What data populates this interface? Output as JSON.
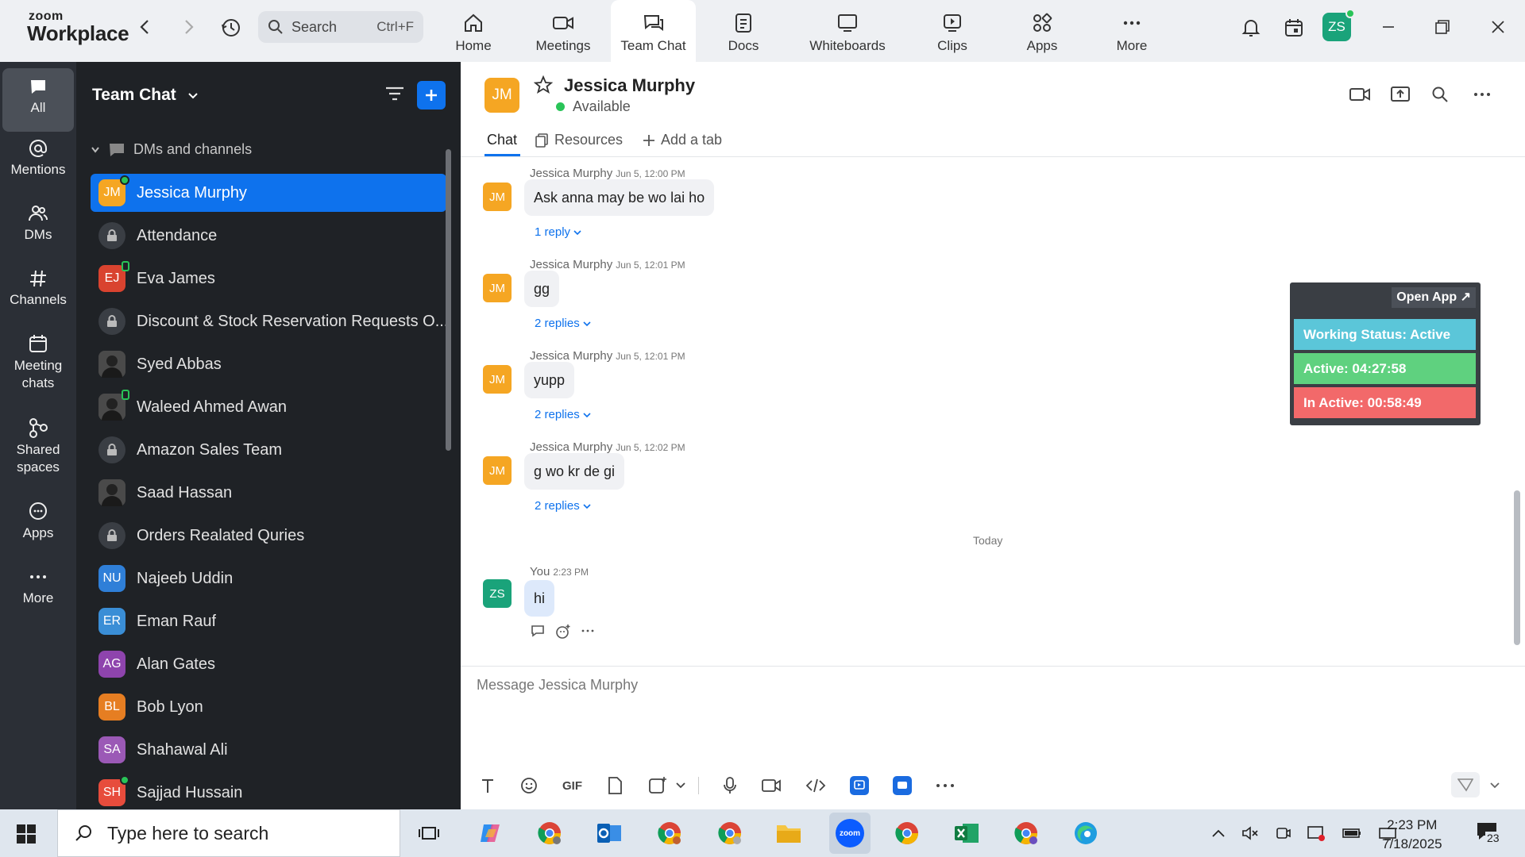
{
  "app": {
    "logo_top": "zoom",
    "logo_bottom": "Workplace"
  },
  "topbar": {
    "search_label": "Search",
    "search_shortcut": "Ctrl+F",
    "nav": [
      "Home",
      "Meetings",
      "Team Chat",
      "Docs",
      "Whiteboards",
      "Clips",
      "Apps",
      "More"
    ],
    "active_nav": "Team Chat",
    "user_initials": "ZS"
  },
  "rail": [
    "All",
    "Mentions",
    "DMs",
    "Channels",
    "Meeting chats",
    "Shared spaces",
    "Apps",
    "More"
  ],
  "sidebar": {
    "title": "Team Chat",
    "section": "DMs and channels",
    "items": [
      {
        "label": "Jessica Murphy",
        "initials": "JM",
        "kind": "avatar",
        "color": "#f5a623",
        "status": "green",
        "active": true
      },
      {
        "label": "Attendance",
        "kind": "lock"
      },
      {
        "label": "Eva James",
        "initials": "EJ",
        "kind": "avatar",
        "color": "#d9432f",
        "status": "phone"
      },
      {
        "label": "Discount & Stock Reservation Requests O...",
        "kind": "lock"
      },
      {
        "label": "Syed Abbas",
        "kind": "photo",
        "status": "clock"
      },
      {
        "label": "Waleed Ahmed Awan",
        "kind": "photo",
        "status": "phone"
      },
      {
        "label": "Amazon Sales Team",
        "kind": "lock"
      },
      {
        "label": "Saad Hassan",
        "kind": "photo",
        "status": "clock"
      },
      {
        "label": "Orders Realated Quries",
        "kind": "lock"
      },
      {
        "label": "Najeeb Uddin",
        "initials": "NU",
        "kind": "avatar",
        "color": "#2f7fd8",
        "status": "clock"
      },
      {
        "label": "Eman Rauf",
        "initials": "ER",
        "kind": "avatar",
        "color": "#3a8ed6",
        "status": "clock"
      },
      {
        "label": "Alan Gates",
        "initials": "AG",
        "kind": "avatar",
        "color": "#8e44ad",
        "status": "clock"
      },
      {
        "label": "Bob Lyon",
        "initials": "BL",
        "kind": "avatar",
        "color": "#e67e22",
        "status": "clock"
      },
      {
        "label": "Shahawal Ali",
        "initials": "SA",
        "kind": "avatar",
        "color": "#9b59b6",
        "status": "clock"
      },
      {
        "label": "Sajjad Hussain",
        "initials": "SH",
        "kind": "avatar",
        "color": "#e74c3c",
        "status": "green"
      }
    ]
  },
  "chat": {
    "contact_initials": "JM",
    "contact_name": "Jessica Murphy",
    "contact_status": "Available",
    "tabs": [
      "Chat",
      "Resources",
      "Add a tab"
    ],
    "messages": [
      {
        "author": "Jessica Murphy",
        "time": "Jun 5, 12:00 PM",
        "text": "Ask anna may be wo lai ho",
        "replies": "1 reply"
      },
      {
        "author": "Jessica Murphy",
        "time": "Jun 5, 12:01 PM",
        "text": "gg",
        "replies": "2 replies"
      },
      {
        "author": "Jessica Murphy",
        "time": "Jun 5, 12:01 PM",
        "text": "yupp",
        "replies": "2 replies"
      },
      {
        "author": "Jessica Murphy",
        "time": "Jun 5, 12:02 PM",
        "text": "g wo kr de gi",
        "replies": "2 replies"
      }
    ],
    "divider": "Today",
    "own_message": {
      "author": "You",
      "time": "2:23 PM",
      "text": "hi",
      "initials": "ZS"
    },
    "composer_placeholder": "Message Jessica Murphy",
    "gif_label": "GIF"
  },
  "widget": {
    "open_label": "Open App ↗",
    "working": "Working Status: Active",
    "active": "Active: 04:27:58",
    "inactive": "In Active: 00:58:49"
  },
  "taskbar": {
    "search_placeholder": "Type here to search",
    "time": "2:23 PM",
    "date": "7/18/2025",
    "notifications": "23"
  },
  "colors": {
    "accent": "#0e72ed",
    "green": "#29c458",
    "sidebar_bg": "#1f2226",
    "rail_bg": "#2b2f36"
  }
}
